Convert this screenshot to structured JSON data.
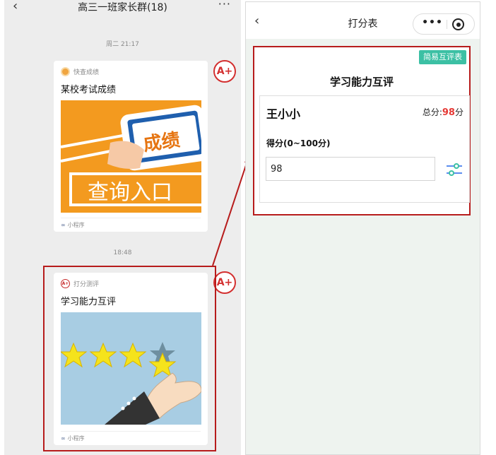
{
  "left_chat": {
    "title": "高三一班家长群(18)",
    "timestamps": [
      "周二 21:17",
      "18:48"
    ],
    "cards": [
      {
        "source": "快查成绩",
        "title": "某校考试成绩",
        "image_text_top": "成绩",
        "image_text_bottom": "查询入口",
        "footer": "小程序"
      },
      {
        "source": "打分测评",
        "title": "学习能力互评",
        "footer": "小程序"
      }
    ],
    "avatar_label": "A+"
  },
  "right_panel": {
    "nav_title": "打分表",
    "badge": "简易互评表",
    "form_title": "学习能力互评",
    "student_name": "王小小",
    "total_label": "总分:",
    "total_value": "98",
    "total_unit": "分",
    "score_label": "得分(0~100分)",
    "score_value": "98"
  },
  "colors": {
    "accent_red": "#b71c1c",
    "badge_teal": "#3cc0a4",
    "score_red": "#e53935",
    "chat_bg": "#ededed"
  },
  "icons": [
    "back-arrow-icon",
    "more-dots-icon",
    "miniprogram-link-icon",
    "capsule-more-icon",
    "capsule-close-icon",
    "slider-adjust-icon"
  ]
}
